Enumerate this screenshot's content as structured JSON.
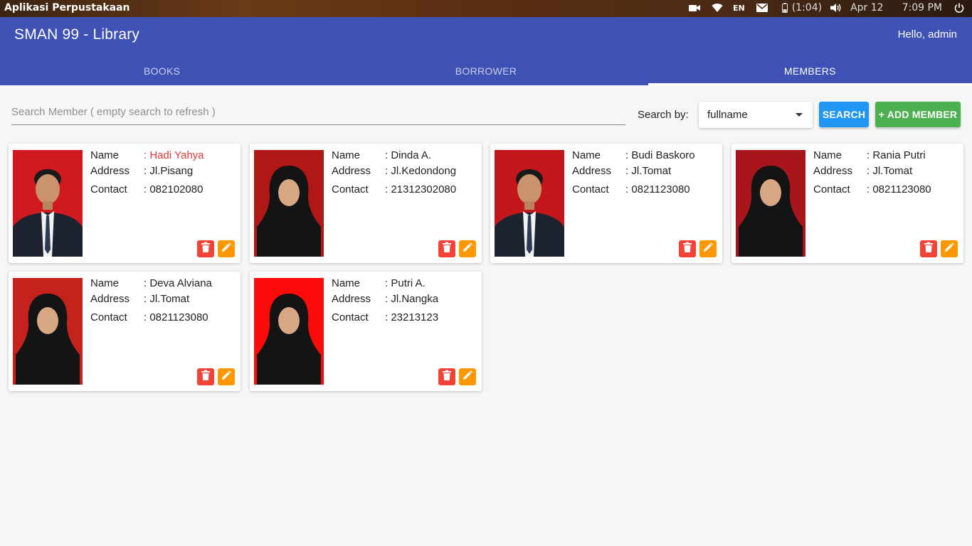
{
  "system_bar": {
    "title": "Aplikasi Perpustakaan",
    "language": "EN",
    "battery": "(1:04)",
    "date": "Apr 12",
    "time": "7:09 PM"
  },
  "header": {
    "title": "SMAN 99 - Library",
    "greeting": "Hello, admin"
  },
  "tabs": [
    {
      "label": "BOOKS"
    },
    {
      "label": "BORROWER"
    },
    {
      "label": "MEMBERS"
    }
  ],
  "active_tab": "MEMBERS",
  "search": {
    "placeholder": "Search Member ( empty search to refresh )",
    "value": "",
    "search_by_label": "Search by:",
    "search_by_value": "fullname",
    "search_button": "SEARCH",
    "add_button": "+ ADD MEMBER"
  },
  "labels": {
    "name": "Name",
    "address": "Address",
    "contact": "Contact"
  },
  "members": [
    {
      "name": "Hadi Yahya",
      "address": "Jl.Pisang",
      "contact": "082102080",
      "photo_bg": "#d11a1f",
      "highlight": true
    },
    {
      "name": "Dinda A.",
      "address": "Jl.Kedondong",
      "contact": "21312302080",
      "photo_bg": "#b01818",
      "highlight": false
    },
    {
      "name": "Budi Baskoro",
      "address": "Jl.Tomat",
      "contact": "0821123080",
      "photo_bg": "#c3161a",
      "highlight": false
    },
    {
      "name": "Rania Putri",
      "address": "Jl.Tomat",
      "contact": "0821123080",
      "photo_bg": "#a8161c",
      "highlight": false
    },
    {
      "name": "Deva Alviana",
      "address": "Jl.Tomat",
      "contact": "0821123080",
      "photo_bg": "#c4231d",
      "highlight": false
    },
    {
      "name": "Putri A.",
      "address": "Jl.Nangka",
      "contact": "23213123",
      "photo_bg": "#ff0a0a",
      "highlight": false
    }
  ],
  "colors": {
    "primary": "#3f51b5",
    "search_button": "#2196f3",
    "add_button": "#4caf50",
    "delete": "#f44336",
    "edit": "#ff9800",
    "highlight_name": "#e53935"
  },
  "icons": {
    "delete": "trash-icon",
    "edit": "pencil-icon"
  }
}
